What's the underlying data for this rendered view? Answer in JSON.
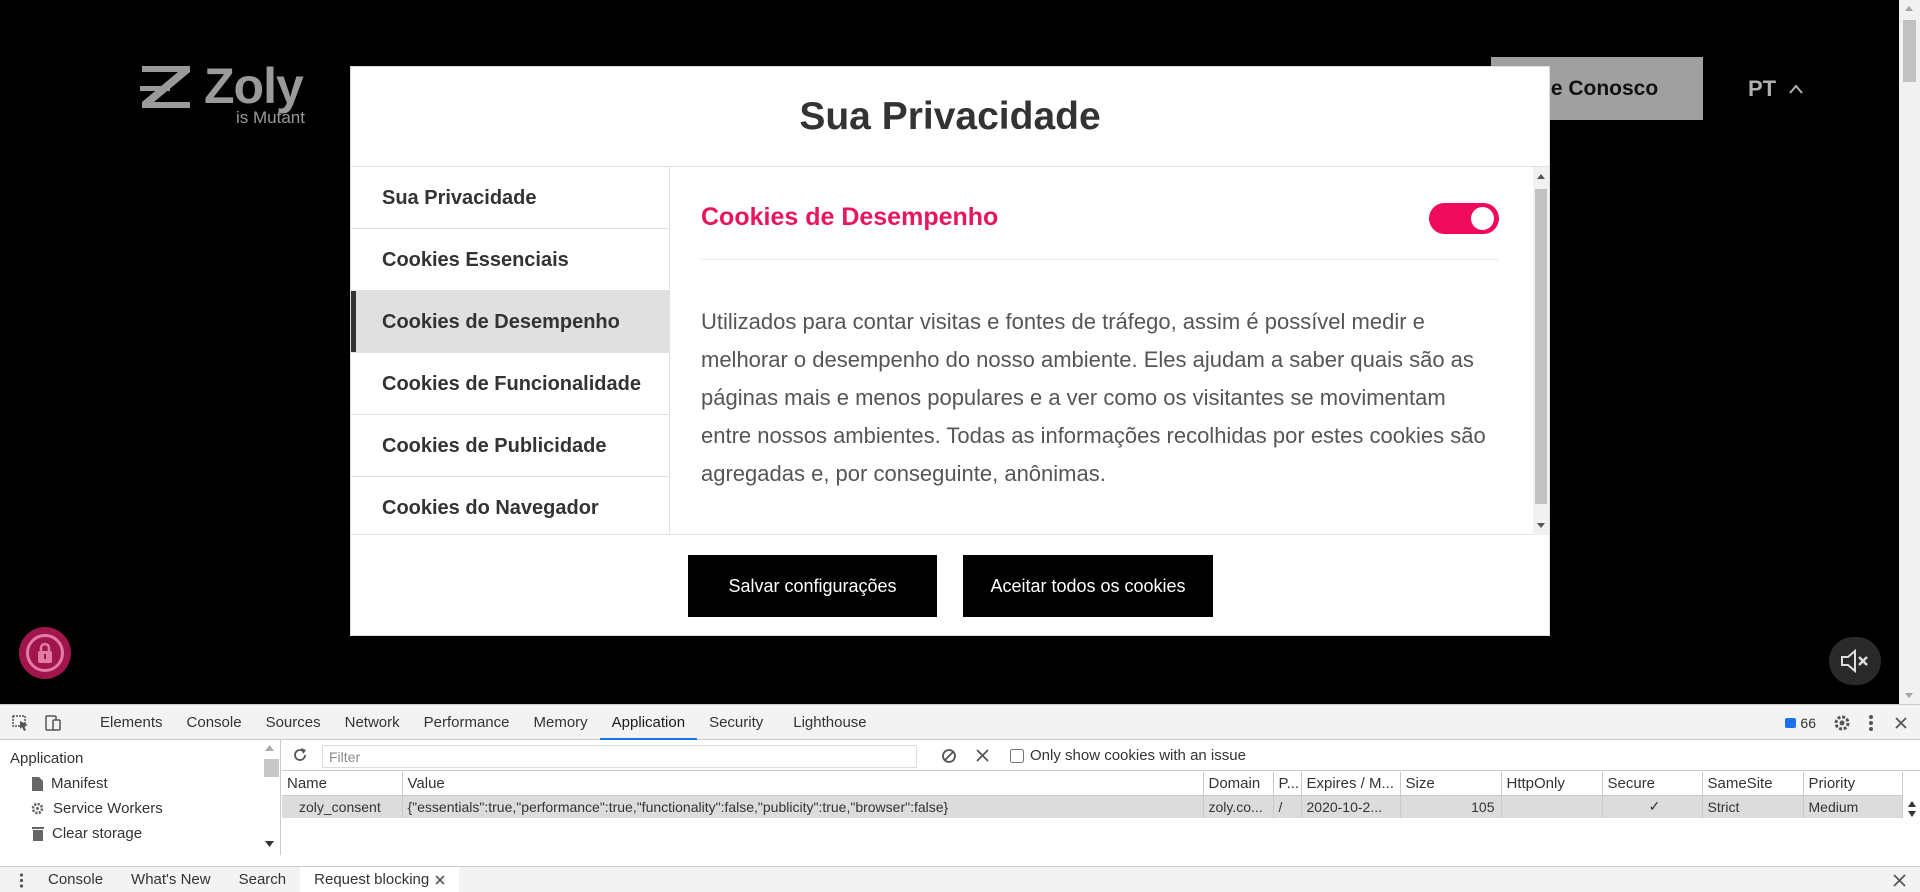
{
  "site": {
    "logo_word": "Zoly",
    "logo_sub": "is Mutant",
    "contact_label": "le Conosco",
    "language": "PT"
  },
  "modal": {
    "title": "Sua Privacidade",
    "nav": [
      {
        "label": "Sua Privacidade"
      },
      {
        "label": "Cookies Essenciais"
      },
      {
        "label": "Cookies de Desempenho"
      },
      {
        "label": "Cookies de Funcionalidade"
      },
      {
        "label": "Cookies de Publicidade"
      },
      {
        "label": "Cookies do Navegador"
      }
    ],
    "active_index": 2,
    "section_title": "Cookies de Desempenho",
    "toggle_on": true,
    "section_text": "Utilizados para contar visitas e fontes de tráfego, assim é possível medir e melhorar o desempenho do nosso ambiente. Eles ajudam a saber quais são as páginas mais e menos populares e a ver como os visitantes se movimentam entre nossos ambientes. Todas as informações recolhidas por estes cookies são agregadas e, por conseguinte, anônimas.",
    "save_label": "Salvar configurações",
    "accept_label": "Aceitar todos os cookies",
    "accent_color": "#e8155f"
  },
  "devtools": {
    "tabs": [
      "Elements",
      "Console",
      "Sources",
      "Network",
      "Performance",
      "Memory",
      "Application",
      "Security",
      "Lighthouse"
    ],
    "active_tab": "Application",
    "issues_count": "66",
    "sidebar": {
      "title": "Application",
      "items": [
        "Manifest",
        "Service Workers",
        "Clear storage"
      ]
    },
    "filter_placeholder": "Filter",
    "only_issue_label": "Only show cookies with an issue",
    "columns": [
      "Name",
      "Value",
      "Domain",
      "P...",
      "Expires / M...",
      "Size",
      "HttpOnly",
      "Secure",
      "SameSite",
      "Priority"
    ],
    "row": {
      "name": "zoly_consent",
      "value": "{\"essentials\":true,\"performance\":true,\"functionality\":false,\"publicity\":true,\"browser\":false}",
      "domain": "zoly.co...",
      "path": "/",
      "expires": "2020-10-2...",
      "size": "105",
      "httponly": "",
      "secure": "✓",
      "samesite": "Strict",
      "priority": "Medium"
    },
    "drawer_tabs": [
      "Console",
      "What's New",
      "Search",
      "Request blocking"
    ]
  }
}
